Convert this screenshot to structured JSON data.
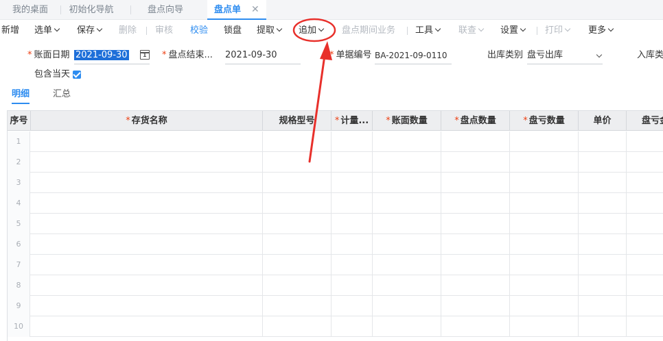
{
  "tabs": [
    {
      "label": "我的桌面"
    },
    {
      "label": "初始化导航"
    },
    {
      "label": "盘点向导"
    },
    {
      "label": "盘点单",
      "active": true
    }
  ],
  "tab_close_glyph": "✕",
  "toolbar": {
    "items": [
      {
        "label": "新增"
      },
      {
        "label": "选单"
      },
      {
        "label": "保存"
      },
      {
        "label": "删除"
      },
      {
        "label": "审核"
      },
      {
        "label": "校验"
      },
      {
        "label": "锁盘"
      },
      {
        "label": "提取"
      },
      {
        "label": "追加"
      },
      {
        "label": "盘点期间业务"
      },
      {
        "label": "工具"
      },
      {
        "label": "联查"
      },
      {
        "label": "设置"
      },
      {
        "label": "打印"
      },
      {
        "label": "更多"
      }
    ]
  },
  "form": {
    "book_date_label": "账面日期",
    "book_date_value": "2021-09-30",
    "end_date_label": "盘点结束...",
    "end_date_value": "2021-09-30",
    "doc_no_label": "单据编号",
    "doc_no_value": "BA-2021-09-0110",
    "out_type_label": "出库类别",
    "out_type_value": "盘亏出库",
    "in_type_label": "入库类",
    "include_today_label": "包含当天",
    "include_today_checked": true
  },
  "subtabs": [
    {
      "label": "明细",
      "active": true
    },
    {
      "label": "汇总"
    }
  ],
  "grid": {
    "columns": [
      {
        "label": "序号",
        "required": false
      },
      {
        "label": "存货名称",
        "required": true
      },
      {
        "label": "规格型号",
        "required": false
      },
      {
        "label": "计量...",
        "required": true
      },
      {
        "label": "账面数量",
        "required": true
      },
      {
        "label": "盘点数量",
        "required": true
      },
      {
        "label": "盘亏数量",
        "required": true
      },
      {
        "label": "单价",
        "required": false
      },
      {
        "label": "盘亏金",
        "required": false
      }
    ],
    "row_numbers": [
      "1",
      "2",
      "3",
      "4",
      "5",
      "6",
      "7",
      "8",
      "9",
      "10"
    ]
  },
  "colors": {
    "accent": "#2d8cf0",
    "annotation_red": "#e8302b",
    "required_star": "#ed4014"
  }
}
